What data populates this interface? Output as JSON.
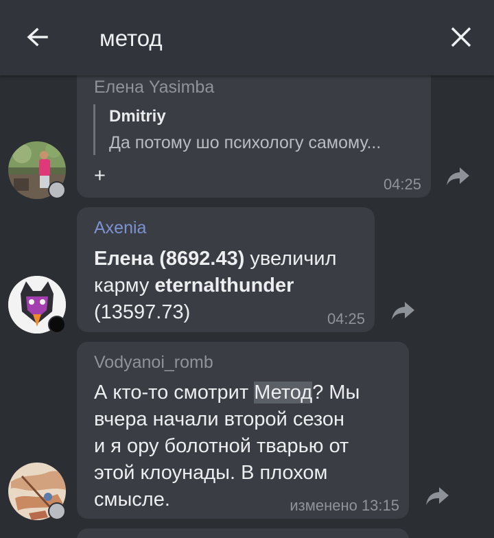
{
  "header": {
    "search_value": "метод"
  },
  "messages": [
    {
      "sender": "Елена Yasimba",
      "reply_author": "Dmitriy",
      "reply_text": "Да потому шо психологу самому...",
      "text": "+",
      "time": "04:25",
      "avatar_icon": "photo-avatar"
    },
    {
      "sender": "Axenia",
      "text_parts": [
        "Елена (8692.43)",
        " увеличил",
        "карму ",
        "eternalthunder",
        "(13597.73)"
      ],
      "time": "04:25",
      "avatar_icon": "cat-avatar"
    },
    {
      "sender": "Vodyanoi_romb",
      "text_parts": [
        "А кто-то смотрит ",
        "Метод",
        "? Мы",
        "вчера начали второй сезон",
        "и я ору болотной тварью от",
        "этой клоунады. В плохом",
        "смысле."
      ],
      "time": "изменено 13:15",
      "avatar_icon": "drawing-avatar"
    }
  ],
  "colors": {
    "background": "#2b2e33",
    "header": "#31343a",
    "bubble": "#3a3d43",
    "sender_gray": "#8f949a",
    "sender_blue": "#7d92d2",
    "highlight": "#5b5f66"
  }
}
